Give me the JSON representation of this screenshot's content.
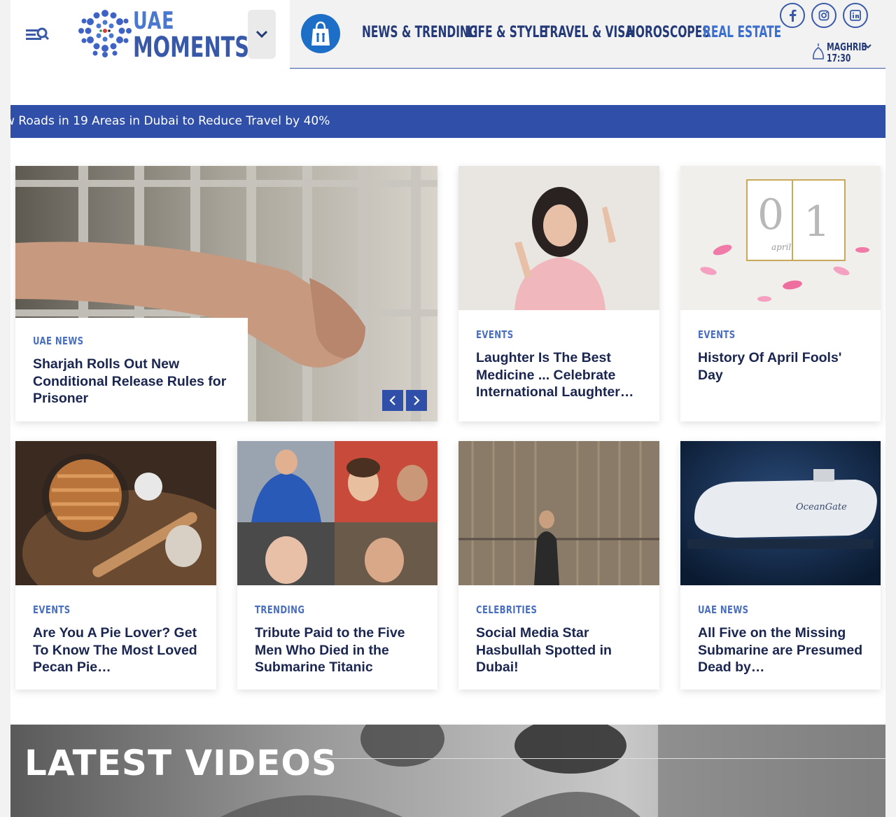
{
  "header": {
    "logo_line1": "UAE",
    "logo_line2": "MOMENTS",
    "nav": [
      "NEWS & TRENDING",
      "LIFE & STYLE",
      "TRAVEL & VISA",
      "HOROSCOPES",
      "REAL ESTATE"
    ],
    "nav_active_color": "#3a6fd0",
    "social": [
      "facebook-icon",
      "instagram-icon",
      "linkedin-icon"
    ],
    "prayer_name": "MAGHRIB",
    "prayer_time": "17:30"
  },
  "ticker": {
    "text": "w Roads in 19 Areas in Dubai to Reduce Travel by 40%"
  },
  "hero": {
    "category": "UAE NEWS",
    "title": "Sharjah Rolls Out New Conditional Release Rules for Prisoner"
  },
  "cards": [
    {
      "category": "EVENTS",
      "title": "Laughter Is The Best Medicine ... Celebrate International Laughter…"
    },
    {
      "category": "EVENTS",
      "title": "History Of April Fools' Day"
    },
    {
      "category": "EVENTS",
      "title": "Are You A Pie Lover? Get To Know The Most Loved Pecan Pie…"
    },
    {
      "category": "TRENDING",
      "title": "Tribute Paid to the Five Men Who Died in the Submarine Titanic"
    },
    {
      "category": "CELEBRITIES",
      "title": "Social Media Star Hasbullah Spotted in Dubai!"
    },
    {
      "category": "UAE NEWS",
      "title": "All Five on the Missing Submarine are Presumed Dead by…"
    }
  ],
  "calendar_digits": [
    "0",
    "1"
  ],
  "calendar_word": "april",
  "submarine_brand": "OceanGate",
  "videos": {
    "title": "LATEST VIDEOS"
  },
  "colors": {
    "brand_blue": "#2f4fa8",
    "navy_text": "#1a2550",
    "category_blue": "#4a6fbf"
  }
}
